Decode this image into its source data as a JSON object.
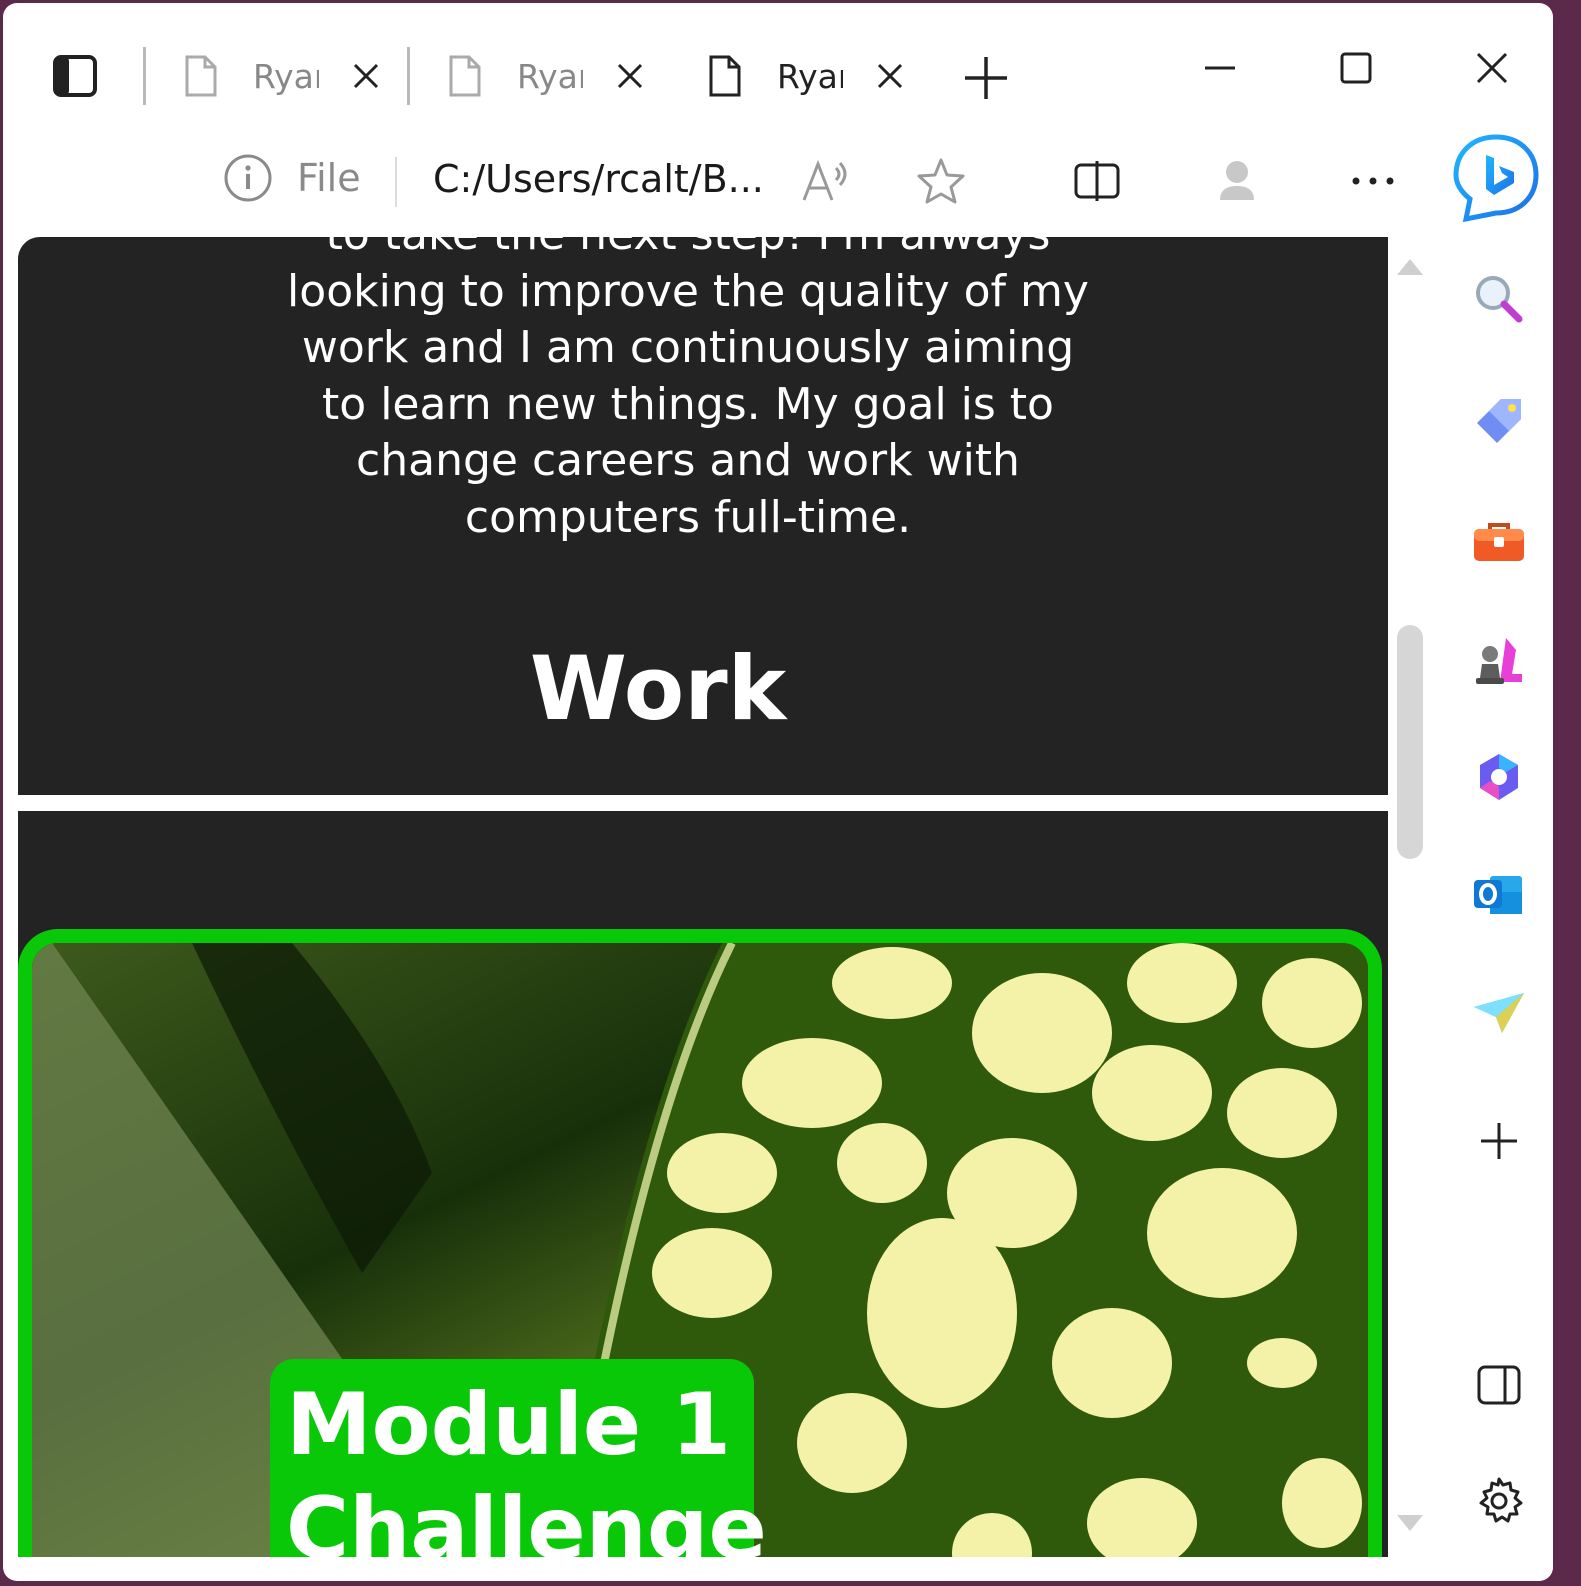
{
  "tabs": [
    {
      "title": "Ryan",
      "active": false
    },
    {
      "title": "Ryan",
      "active": false
    },
    {
      "title": "Ryan",
      "active": true
    }
  ],
  "address_bar": {
    "site_info_label": "File",
    "url": "C:/Users/rcalt/B..."
  },
  "page": {
    "about_text": "to take the next step! I'm always looking to improve the quality of my work and I am continuously aiming to learn new things. My goal is to change careers and work with computers full-time.",
    "work_heading": "Work",
    "card_title_line1": "Module 1",
    "card_title_line2": "Challenge"
  },
  "colors": {
    "page_bg": "#232323",
    "accent_green": "#08c808",
    "text": "#ffffff"
  },
  "sidebar_icons": [
    "bing-copilot-icon",
    "search-icon",
    "shopping-tag-icon",
    "tools-briefcase-icon",
    "games-chess-icon",
    "microsoft-365-icon",
    "outlook-icon",
    "send-drop-icon",
    "add-icon",
    "hide-sidebar-icon",
    "settings-gear-icon"
  ]
}
